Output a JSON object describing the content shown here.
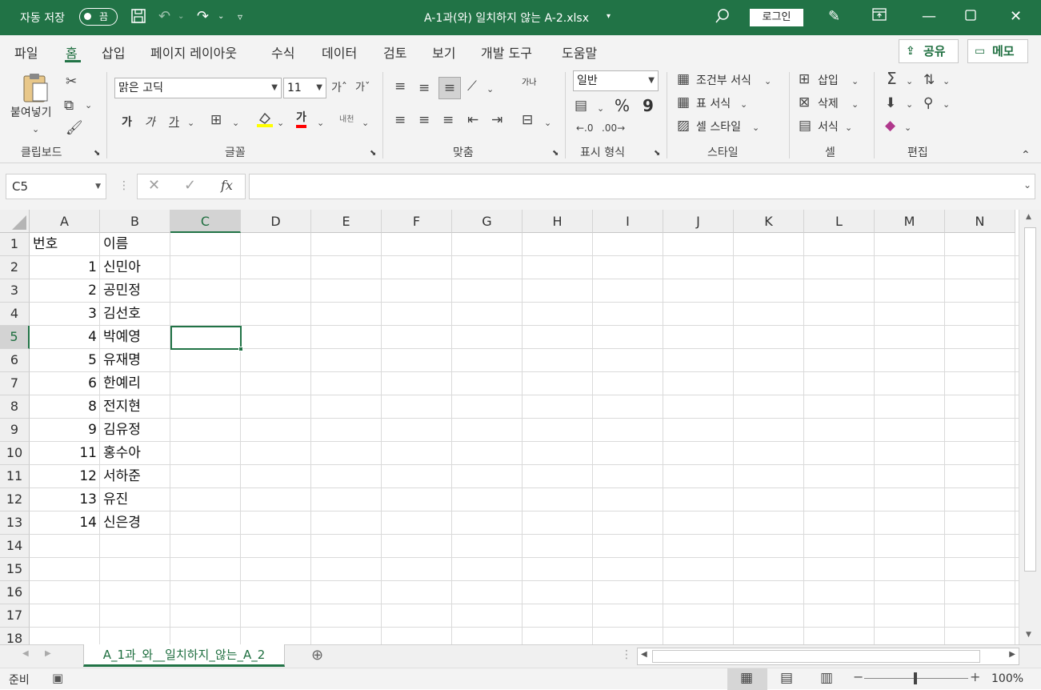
{
  "titlebar": {
    "autosave_label": "자동 저장",
    "autosave_state": "끔",
    "doc_title": "A-1과(와) 일치하지 않는 A-2.xlsx",
    "login_label": "로그인",
    "icons": [
      "save-icon",
      "undo-icon",
      "redo-icon",
      "customize-icon",
      "search-icon",
      "pen-icon",
      "ribbon-display-icon",
      "minimize-icon",
      "maximize-icon",
      "close-icon"
    ]
  },
  "menu": {
    "tabs": [
      "파일",
      "홈",
      "삽입",
      "페이지 레이아웃",
      "수식",
      "데이터",
      "검토",
      "보기",
      "개발 도구",
      "도움말"
    ],
    "active_tab": "홈",
    "share_label": "공유",
    "memo_label": "메모"
  },
  "ribbon": {
    "clipboard": {
      "paste_label": "붙여넣기",
      "group_label": "클립보드"
    },
    "font": {
      "font_name": "맑은 고딕",
      "font_size": "11",
      "group_label": "글꼴",
      "bold": "가",
      "italic": "가",
      "underline": "가",
      "font_color_glyph": "가",
      "phonetic_label": "내천"
    },
    "alignment": {
      "group_label": "맞춤",
      "wrap_glyph": "가나"
    },
    "number": {
      "format": "일반",
      "group_label": "표시 형식",
      "percent": "%",
      "comma": "9"
    },
    "styles": {
      "conditional_label": "조건부 서식",
      "table_label": "표 서식",
      "cell_style_label": "셀 스타일",
      "group_label": "스타일"
    },
    "cells": {
      "insert_label": "삽입",
      "delete_label": "삭제",
      "format_label": "서식",
      "group_label": "셀"
    },
    "editing": {
      "group_label": "편집"
    }
  },
  "formula_bar": {
    "name_box": "C5",
    "formula": ""
  },
  "sheet": {
    "columns": [
      "A",
      "B",
      "C",
      "D",
      "E",
      "F",
      "G",
      "H",
      "I",
      "J",
      "K",
      "L",
      "M",
      "N"
    ],
    "selected_column": "C",
    "rows": [
      "1",
      "2",
      "3",
      "4",
      "5",
      "6",
      "7",
      "8",
      "9",
      "10",
      "11",
      "12",
      "13",
      "14",
      "15",
      "16",
      "17",
      "18"
    ],
    "selected_row": "5",
    "data": [
      [
        "번호",
        "이름"
      ],
      [
        "1",
        "신민아"
      ],
      [
        "2",
        "공민정"
      ],
      [
        "3",
        "김선호"
      ],
      [
        "4",
        "박예영"
      ],
      [
        "5",
        "유재명"
      ],
      [
        "6",
        "한예리"
      ],
      [
        "8",
        "전지현"
      ],
      [
        "9",
        "김유정"
      ],
      [
        "11",
        "홍수아"
      ],
      [
        "12",
        "서하준"
      ],
      [
        "13",
        "유진"
      ],
      [
        "14",
        "신은경"
      ]
    ],
    "active_cell": "C5"
  },
  "sheet_tabs": {
    "tabs": [
      "A_1과_와__일치하지_않는_A_2"
    ],
    "active": 0
  },
  "status": {
    "ready_label": "준비",
    "zoom": "100%"
  }
}
